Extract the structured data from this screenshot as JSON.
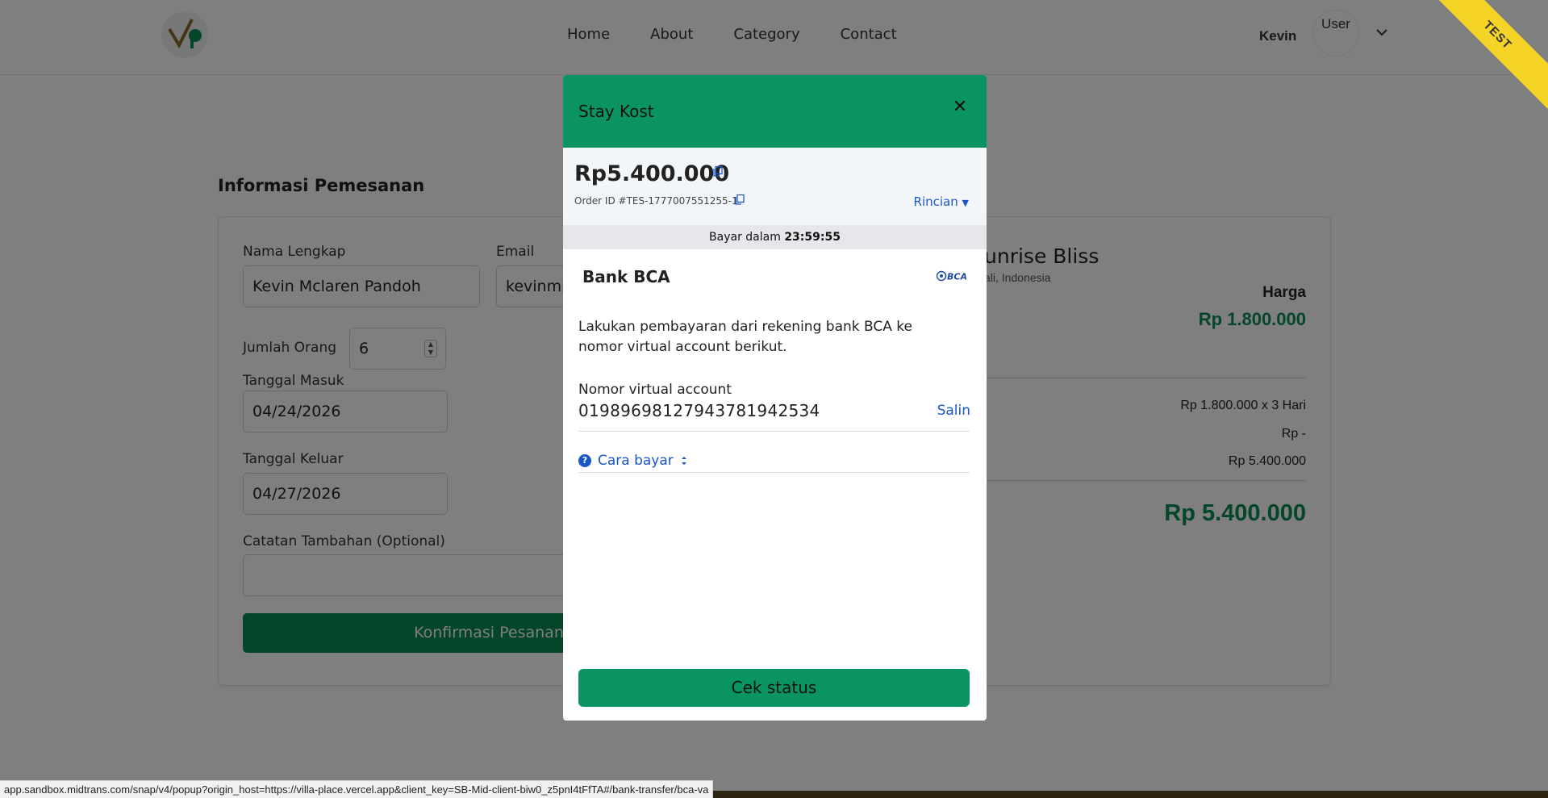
{
  "nav": {
    "links": [
      "Home",
      "About",
      "Category",
      "Contact"
    ],
    "user_name": "Kevin",
    "avatar_text": "User"
  },
  "ribbon": {
    "text": "TEST"
  },
  "booking": {
    "title": "Informasi Pemesanan",
    "full_name_label": "Nama Lengkap",
    "full_name_value": "Kevin Mclaren Pandoh",
    "email_label": "Email",
    "email_value": "kevinmp",
    "people_label": "Jumlah Orang",
    "people_value": "6",
    "checkin_label": "Tanggal Masuk",
    "checkin_value": "04/24/2026",
    "checkout_label": "Tanggal Keluar",
    "checkout_value": "04/27/2026",
    "notes_label": "Catatan Tambahan (Optional)",
    "confirm_label": "Konfirmasi Pesanan"
  },
  "summary": {
    "villa_name": "unrise Bliss",
    "location": "ali, Indonesia",
    "price_label": "Harga",
    "price_value": "Rp 1.800.000",
    "calc_line": "Rp 1.800.000 x 3 Hari",
    "discount_line": "Rp -",
    "subtotal_line": "Rp 5.400.000",
    "total_value": "Rp 5.400.000"
  },
  "modal": {
    "merchant": "Stay Kost",
    "amount": "Rp5.400.000",
    "order_id": "Order ID #TES-1777007551255-1",
    "rincian_label": "Rincian",
    "timer_label": "Bayar dalam",
    "timer_value": "23:59:55",
    "bank_name": "Bank BCA",
    "bank_logo_text": "BCA",
    "instruction": "Lakukan pembayaran dari rekening bank BCA ke nomor virtual account berikut.",
    "va_label": "Nomor virtual account",
    "va_number": "01989698127943781942534",
    "copy_label": "Salin",
    "how_to_pay": "Cara bayar",
    "check_status": "Cek status"
  },
  "status_bar": {
    "url": "app.sandbox.midtrans.com/snap/v4/popup?origin_host=https://villa-place.vercel.app&client_key=SB-Mid-client-biw0_z5pnI4tFfTA#/bank-transfer/bca-va"
  },
  "colors": {
    "brand_green": "#0a9461",
    "link_blue": "#1a56c9",
    "ribbon_yellow": "#f5d327"
  }
}
